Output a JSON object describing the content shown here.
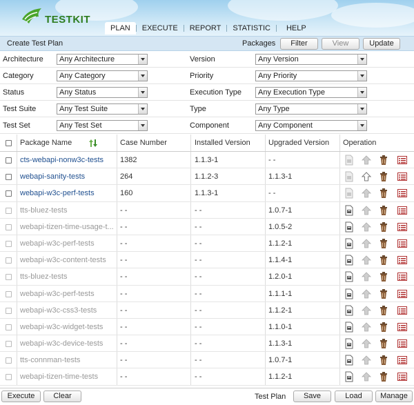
{
  "app": {
    "logo_text": "TESTKIT"
  },
  "nav": {
    "items": [
      "PLAN",
      "EXECUTE",
      "REPORT",
      "STATISTIC",
      "HELP"
    ],
    "active": "PLAN"
  },
  "toolbar": {
    "title": "Create Test Plan",
    "packages_label": "Packages",
    "filter": "Filter",
    "view": "View",
    "update": "Update"
  },
  "filters": {
    "architecture": {
      "label": "Architecture",
      "value": "Any Architecture"
    },
    "version": {
      "label": "Version",
      "value": "Any Version"
    },
    "category": {
      "label": "Category",
      "value": "Any Category"
    },
    "priority": {
      "label": "Priority",
      "value": "Any Priority"
    },
    "status": {
      "label": "Status",
      "value": "Any Status"
    },
    "execution_type": {
      "label": "Execution Type",
      "value": "Any Execution Type"
    },
    "test_suite": {
      "label": "Test Suite",
      "value": "Any Test Suite"
    },
    "type": {
      "label": "Type",
      "value": "Any Type"
    },
    "test_set": {
      "label": "Test Set",
      "value": "Any Test Set"
    },
    "component": {
      "label": "Component",
      "value": "Any Component"
    }
  },
  "table": {
    "headers": {
      "name": "Package Name",
      "case": "Case Number",
      "installed": "Installed Version",
      "upgraded": "Upgraded Version",
      "operation": "Operation"
    },
    "rows": [
      {
        "name": "cts-webapi-nonw3c-tests",
        "case": "1382",
        "installed": "1.1.3-1",
        "upgraded": "- -",
        "installed_pkg": true
      },
      {
        "name": "webapi-sanity-tests",
        "case": "264",
        "installed": "1.1.2-3",
        "upgraded": "1.1.3-1",
        "installed_pkg": true
      },
      {
        "name": "webapi-w3c-perf-tests",
        "case": "160",
        "installed": "1.1.3-1",
        "upgraded": "- -",
        "installed_pkg": true
      },
      {
        "name": "tts-bluez-tests",
        "case": "- -",
        "installed": "- -",
        "upgraded": "1.0.7-1",
        "installed_pkg": false
      },
      {
        "name": "webapi-tizen-time-usage-t...",
        "case": "- -",
        "installed": "- -",
        "upgraded": "1.0.5-2",
        "installed_pkg": false
      },
      {
        "name": "webapi-w3c-perf-tests",
        "case": "- -",
        "installed": "- -",
        "upgraded": "1.1.2-1",
        "installed_pkg": false
      },
      {
        "name": "webapi-w3c-content-tests",
        "case": "- -",
        "installed": "- -",
        "upgraded": "1.1.4-1",
        "installed_pkg": false
      },
      {
        "name": "tts-bluez-tests",
        "case": "- -",
        "installed": "- -",
        "upgraded": "1.2.0-1",
        "installed_pkg": false
      },
      {
        "name": "webapi-w3c-perf-tests",
        "case": "- -",
        "installed": "- -",
        "upgraded": "1.1.1-1",
        "installed_pkg": false
      },
      {
        "name": "webapi-w3c-css3-tests",
        "case": "- -",
        "installed": "- -",
        "upgraded": "1.1.2-1",
        "installed_pkg": false
      },
      {
        "name": "webapi-w3c-widget-tests",
        "case": "- -",
        "installed": "- -",
        "upgraded": "1.1.0-1",
        "installed_pkg": false
      },
      {
        "name": "webapi-w3c-device-tests",
        "case": "- -",
        "installed": "- -",
        "upgraded": "1.1.3-1",
        "installed_pkg": false
      },
      {
        "name": "tts-connman-tests",
        "case": "- -",
        "installed": "- -",
        "upgraded": "1.0.7-1",
        "installed_pkg": false
      },
      {
        "name": "webapi-tizen-time-tests",
        "case": "- -",
        "installed": "- -",
        "upgraded": "1.1.2-1",
        "installed_pkg": false
      }
    ]
  },
  "bottom": {
    "execute": "Execute",
    "clear": "Clear",
    "test_plan_label": "Test Plan",
    "save": "Save",
    "load": "Load",
    "manage": "Manage"
  },
  "colors": {
    "header_sky": "#9fd0ee",
    "toolbar_bg": "#d5e6f3",
    "link_blue": "#1f4f8f",
    "logo_green": "#2e7d1f"
  },
  "icons": {
    "operation": [
      "package-icon",
      "upgrade-arrow-icon",
      "trash-icon",
      "list-icon"
    ]
  }
}
